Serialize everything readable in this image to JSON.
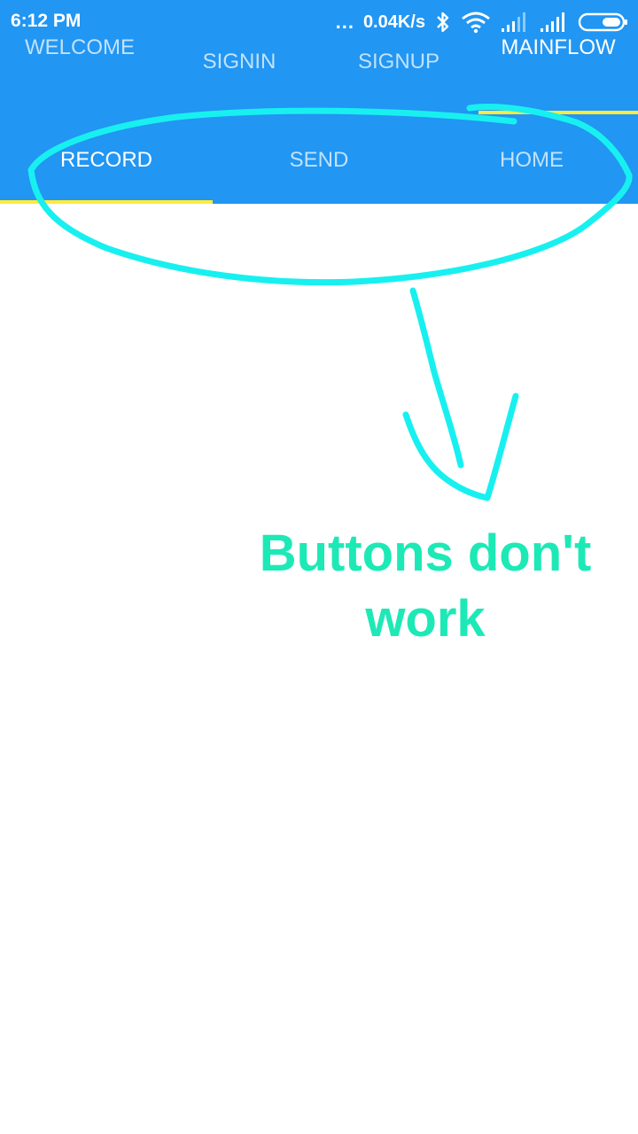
{
  "status_bar": {
    "time": "6:12 PM",
    "dots": "...",
    "network_speed": "0.04K/s",
    "icons": [
      "bluetooth-icon",
      "wifi-icon",
      "signal-icon",
      "signal-icon",
      "battery-icon"
    ]
  },
  "top_tabs": [
    {
      "label": "WELCOME",
      "selected": false
    },
    {
      "label": "SIGNIN",
      "selected": false
    },
    {
      "label": "SIGNUP",
      "selected": false
    },
    {
      "label": "MAINFLOW",
      "selected": true
    }
  ],
  "sub_tabs": [
    {
      "label": "RECORD",
      "selected": true
    },
    {
      "label": "SEND",
      "selected": false
    },
    {
      "label": "HOME",
      "selected": false
    }
  ],
  "annotation": {
    "text": "Buttons don't work",
    "color": "#1DE9B6",
    "outline_color": "#18F0F0"
  },
  "colors": {
    "app_bar": "#2196F3",
    "tab_indicator": "#FFEB3B"
  }
}
